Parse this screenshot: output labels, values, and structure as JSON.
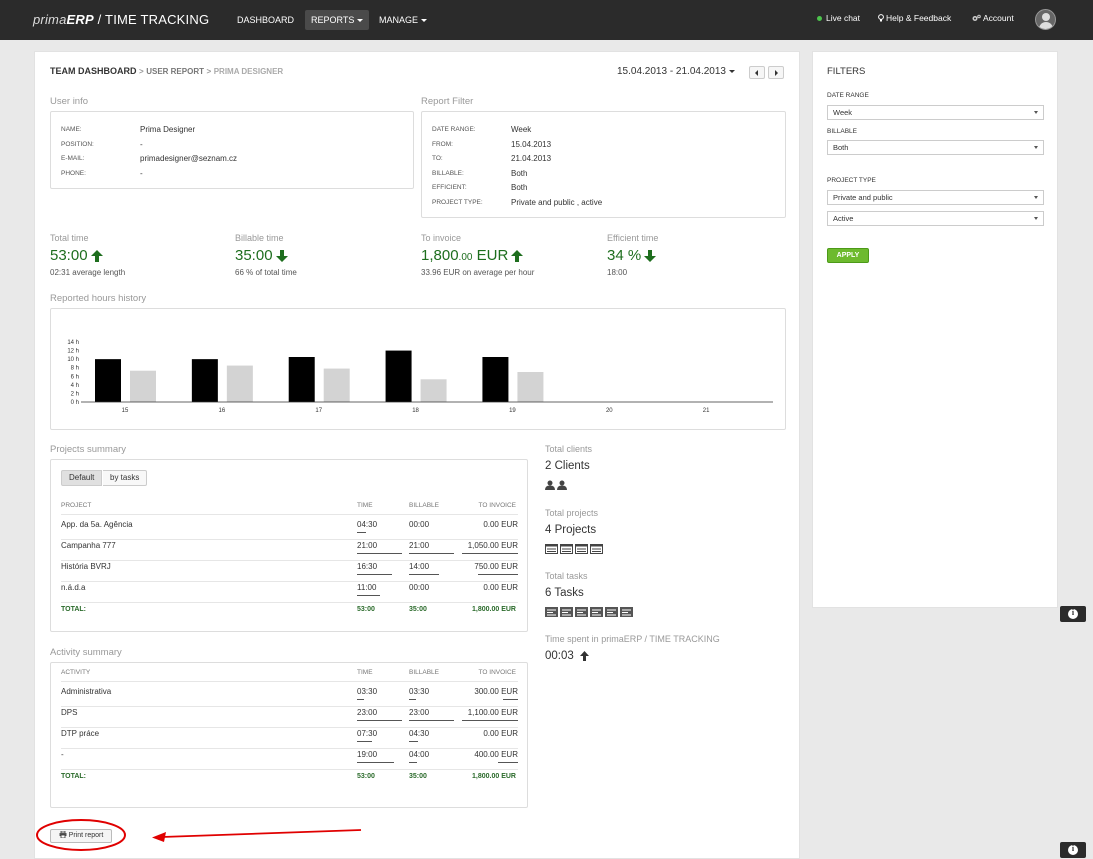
{
  "nav": {
    "brand_prima": "prima",
    "brand_erp": "ERP",
    "brand_rest": " / TIME TRACKING",
    "dashboard": "DASHBOARD",
    "reports": "REPORTS",
    "manage": "MANAGE",
    "live_chat": "Live chat",
    "help": "Help & Feedback",
    "account": "Account"
  },
  "breadcrumb": {
    "team": "TEAM DASHBOARD",
    "sep": ">",
    "user_report": "USER REPORT",
    "current": "PRIMA DESIGNER"
  },
  "date_range": "15.04.2013 - 21.04.2013",
  "user_info": {
    "title": "User info",
    "rows": [
      {
        "label": "NAME:",
        "value": "Prima Designer"
      },
      {
        "label": "POSITION:",
        "value": "-"
      },
      {
        "label": "E-MAIL:",
        "value": "primadesigner@seznam.cz"
      },
      {
        "label": "PHONE:",
        "value": "-"
      }
    ]
  },
  "report_filter": {
    "title": "Report Filter",
    "rows": [
      {
        "label": "DATE RANGE:",
        "value": "Week"
      },
      {
        "label": "FROM:",
        "value": "15.04.2013"
      },
      {
        "label": "TO:",
        "value": "21.04.2013"
      },
      {
        "label": "BILLABLE:",
        "value": "Both"
      },
      {
        "label": "EFFICIENT:",
        "value": "Both"
      },
      {
        "label": "PROJECT TYPE:",
        "value": "Private and public , active"
      }
    ]
  },
  "stats": [
    {
      "label": "Total time",
      "value": "53:00",
      "value_small": "",
      "value_unit": "",
      "sub": "02:31 average length",
      "trend": "up"
    },
    {
      "label": "Billable time",
      "value": "35:00",
      "value_small": "",
      "value_unit": "",
      "sub": "66 % of total time",
      "trend": "down"
    },
    {
      "label": "To invoice",
      "value": "1,800",
      "value_small": ".00",
      "value_unit": " EUR",
      "sub": "33.96 EUR on average per hour",
      "trend": "up"
    },
    {
      "label": "Efficient time",
      "value": "34 %",
      "value_small": "",
      "value_unit": "",
      "sub": "18:00",
      "trend": "down"
    }
  ],
  "history_title": "Reported hours history",
  "chart_data": {
    "type": "bar",
    "categories": [
      "15",
      "16",
      "17",
      "18",
      "19",
      "20",
      "21"
    ],
    "series": [
      {
        "values": [
          10,
          10,
          10.5,
          12,
          10.5,
          0,
          0
        ],
        "color": "#000000"
      },
      {
        "values": [
          7.3,
          8.5,
          7.8,
          5.3,
          7,
          0,
          0
        ],
        "color": "#d3d3d3"
      }
    ],
    "yticks": [
      "0 h",
      "2 h",
      "4 h",
      "6 h",
      "8 h",
      "10 h",
      "12 h",
      "14 h"
    ],
    "ylim": [
      0,
      14
    ],
    "xlabel": "",
    "ylabel": ""
  },
  "projects": {
    "title": "Projects summary",
    "seg_default": "Default",
    "seg_tasks": "by tasks",
    "headers": [
      "PROJECT",
      "TIME",
      "BILLABLE",
      "TO INVOICE"
    ],
    "rows": [
      {
        "name": "App. da 5a. Agência",
        "time": "04:30",
        "billable": "00:00",
        "invoice": "0.00 EUR",
        "tbar": 0.2,
        "bbar": 0,
        "ibar": 0
      },
      {
        "name": "Campanha 777",
        "time": "21:00",
        "billable": "21:00",
        "invoice": "1,050.00 EUR",
        "tbar": 1.0,
        "bbar": 1.0,
        "ibar": 1.0
      },
      {
        "name": "História BVRJ",
        "time": "16:30",
        "billable": "14:00",
        "invoice": "750.00 EUR",
        "tbar": 0.78,
        "bbar": 0.67,
        "ibar": 0.71
      },
      {
        "name": "n.á.d.a",
        "time": "11:00",
        "billable": "00:00",
        "invoice": "0.00 EUR",
        "tbar": 0.52,
        "bbar": 0,
        "ibar": 0
      }
    ],
    "total": {
      "label": "TOTAL:",
      "time": "53:00",
      "billable": "35:00",
      "invoice": "1,800.00 EUR"
    }
  },
  "activities": {
    "title": "Activity summary",
    "headers": [
      "ACTIVITY",
      "TIME",
      "BILLABLE",
      "TO INVOICE"
    ],
    "rows": [
      {
        "name": "Administrativa",
        "time": "03:30",
        "billable": "03:30",
        "invoice": "300.00 EUR",
        "tbar": 0.15,
        "bbar": 0.15,
        "ibar": 0.27
      },
      {
        "name": "DPS",
        "time": "23:00",
        "billable": "23:00",
        "invoice": "1,100.00 EUR",
        "tbar": 1.0,
        "bbar": 1.0,
        "ibar": 1.0
      },
      {
        "name": "DTP práce",
        "time": "07:30",
        "billable": "04:30",
        "invoice": "0.00 EUR",
        "tbar": 0.33,
        "bbar": 0.2,
        "ibar": 0
      },
      {
        "name": "-",
        "time": "19:00",
        "billable": "04:00",
        "invoice": "400.00 EUR",
        "tbar": 0.83,
        "bbar": 0.17,
        "ibar": 0.36
      }
    ],
    "total": {
      "label": "TOTAL:",
      "time": "53:00",
      "billable": "35:00",
      "invoice": "1,800.00 EUR"
    }
  },
  "side_stats": {
    "clients_label": "Total clients",
    "clients_value": "2 Clients",
    "clients_count": 2,
    "projects_label": "Total projects",
    "projects_value": "4 Projects",
    "projects_count": 4,
    "tasks_label": "Total tasks",
    "tasks_value": "6 Tasks",
    "tasks_count": 6,
    "spent_label": "Time spent in primaERP / TIME TRACKING",
    "spent_value": "00:03"
  },
  "print_label": "Print report",
  "filters": {
    "title": "FILTERS",
    "date_range_label": "DATE RANGE",
    "date_range_value": "Week",
    "billable_label": "BILLABLE",
    "billable_value": "Both",
    "project_type_label": "PROJECT TYPE",
    "project_type_value": "Private and public",
    "project_state_value": "Active",
    "apply": "APPLY"
  },
  "colors": {
    "accent_green": "#1e6e1e",
    "apply_green": "#6dba2e",
    "annotation_red": "#e00000"
  }
}
